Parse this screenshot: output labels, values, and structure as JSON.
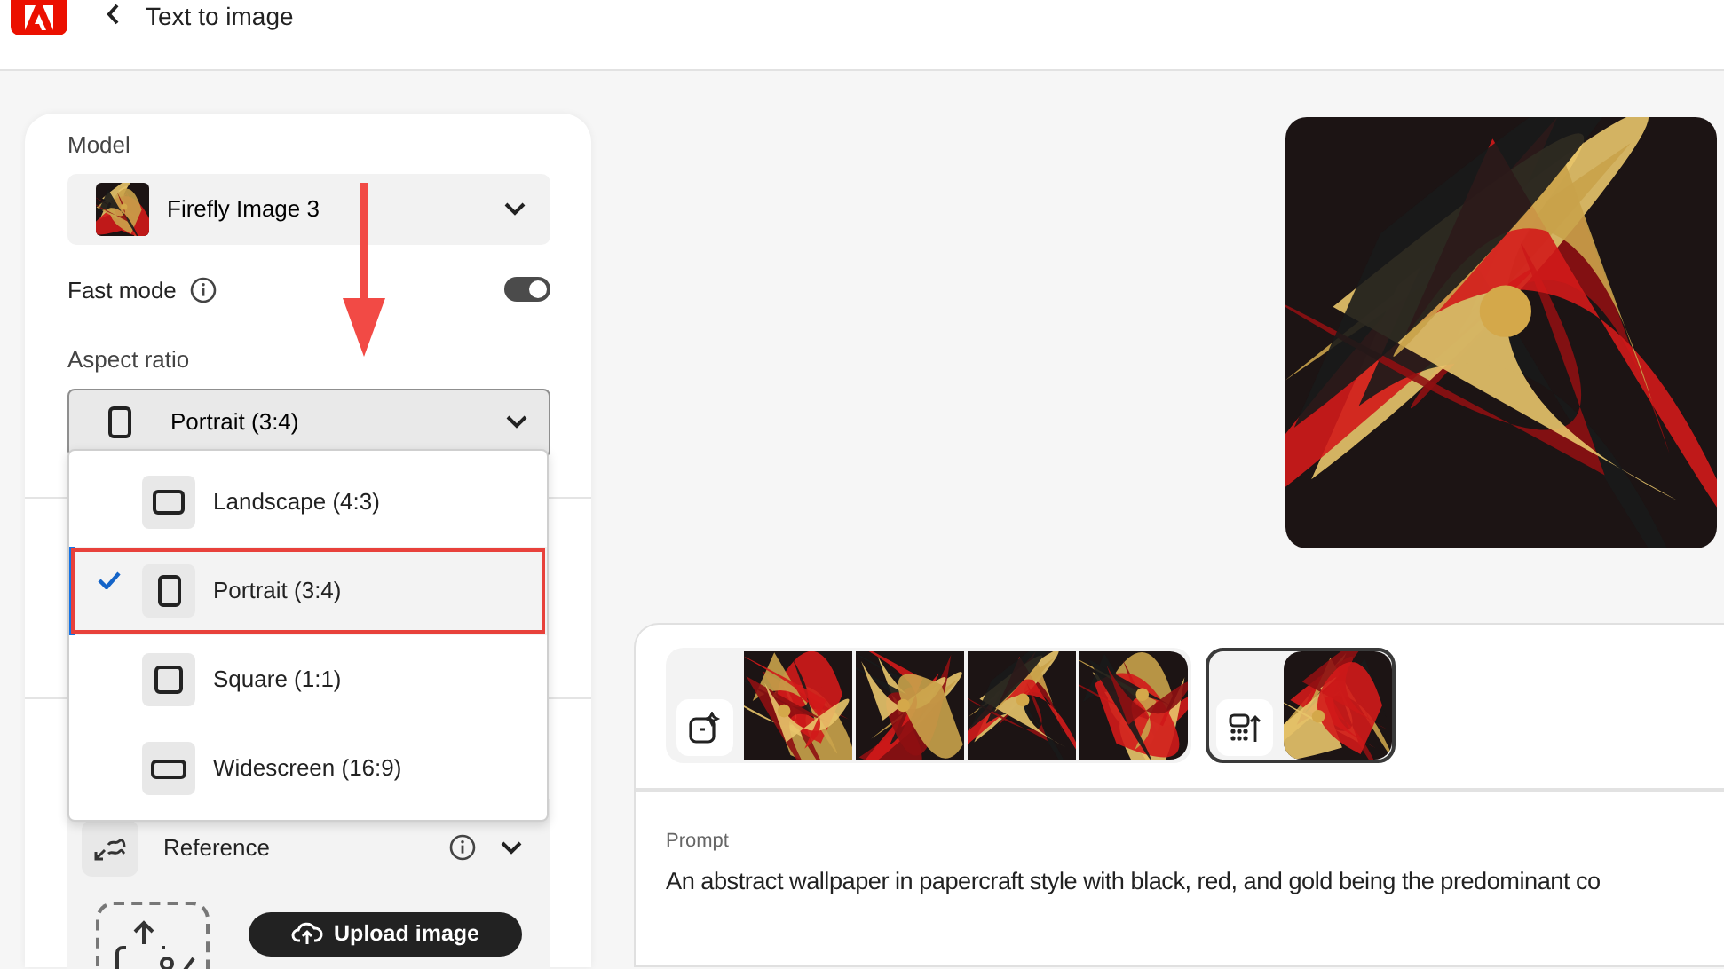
{
  "header": {
    "title": "Text to image"
  },
  "settings": {
    "model": {
      "label": "Model",
      "value": "Firefly Image 3"
    },
    "fast_mode": {
      "label": "Fast mode",
      "on": true
    },
    "aspect_ratio": {
      "label": "Aspect ratio",
      "value": "Portrait (3:4)",
      "kind": "portrait",
      "expanded": true,
      "options": [
        {
          "label": "Landscape (4:3)",
          "kind": "landscape",
          "selected": false,
          "highlighted": false
        },
        {
          "label": "Portrait (3:4)",
          "kind": "portrait",
          "selected": true,
          "highlighted": true
        },
        {
          "label": "Square (1:1)",
          "kind": "square",
          "selected": false,
          "highlighted": false
        },
        {
          "label": "Widescreen (16:9)",
          "kind": "widescreen",
          "selected": false,
          "highlighted": false
        }
      ]
    },
    "reference": {
      "label": "Reference",
      "button": "Upload image"
    }
  },
  "history": [
    {
      "selected": false
    },
    {
      "selected": true
    }
  ],
  "prompt": {
    "label": "Prompt",
    "text": "An abstract wallpaper in papercraft style with black, red, and gold being the predominant co"
  }
}
